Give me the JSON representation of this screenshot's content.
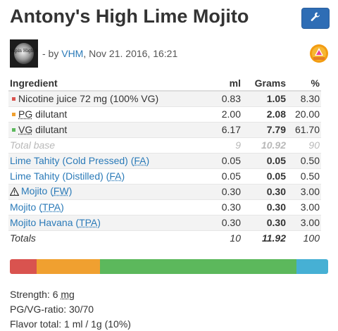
{
  "header": {
    "title": "Antony's High Lime Mojito",
    "tool_icon": "wrench-icon",
    "tool_color": "#2e6db5"
  },
  "author": {
    "by": "- by",
    "name": "VHM",
    "date": ", Nov 21. 2016, 16:21",
    "avatar_text": "Vapin High Mojito",
    "badge_icon": "award-badge-icon"
  },
  "table": {
    "headers": [
      "Ingredient",
      "ml",
      "Grams",
      "%"
    ],
    "base_rows": [
      {
        "name": "Nicotine juice 72 mg (100% VG)",
        "color": "#d9534f",
        "ml": "0.83",
        "grams": "1.05",
        "pct": "8.30"
      },
      {
        "name_abbr": "PG",
        "name_rest": " dilutant",
        "color": "#f0a030",
        "ml": "2.00",
        "grams": "2.08",
        "pct": "20.00"
      },
      {
        "name_abbr": "VG",
        "name_rest": " dilutant",
        "color": "#5cb85c",
        "ml": "6.17",
        "grams": "7.79",
        "pct": "61.70"
      }
    ],
    "total_base": {
      "name": "Total base",
      "ml": "9",
      "grams": "10.92",
      "pct": "90"
    },
    "flavors": [
      {
        "name": "Lime Tahity (Cold Pressed)",
        "vendor": "FA",
        "ml": "0.05",
        "grams": "0.05",
        "pct": "0.50",
        "warning": false
      },
      {
        "name": "Lime Tahity (Distilled)",
        "vendor": "FA",
        "ml": "0.05",
        "grams": "0.05",
        "pct": "0.50",
        "warning": false
      },
      {
        "name": "Mojito",
        "vendor": "FW",
        "ml": "0.30",
        "grams": "0.30",
        "pct": "3.00",
        "warning": true
      },
      {
        "name": "Mojito",
        "vendor": "TPA",
        "ml": "0.30",
        "grams": "0.30",
        "pct": "3.00",
        "warning": false
      },
      {
        "name": "Mojito Havana",
        "vendor": "TPA",
        "ml": "0.30",
        "grams": "0.30",
        "pct": "3.00",
        "warning": false
      }
    ],
    "totals": {
      "name": "Totals",
      "ml": "10",
      "grams": "11.92",
      "pct": "100"
    }
  },
  "ratio_bar": [
    {
      "color": "#d9534f",
      "pct": 8.3
    },
    {
      "color": "#f0a030",
      "pct": 20.0
    },
    {
      "color": "#5cb85c",
      "pct": 61.7
    },
    {
      "color": "#46b0d4",
      "pct": 10.0
    }
  ],
  "stats": {
    "strength_label": "Strength: 6 ",
    "strength_unit": "mg",
    "ratio": "PG/VG-ratio: 30/70",
    "flavor_total": "Flavor total: 1 ml / 1g (10%)"
  }
}
